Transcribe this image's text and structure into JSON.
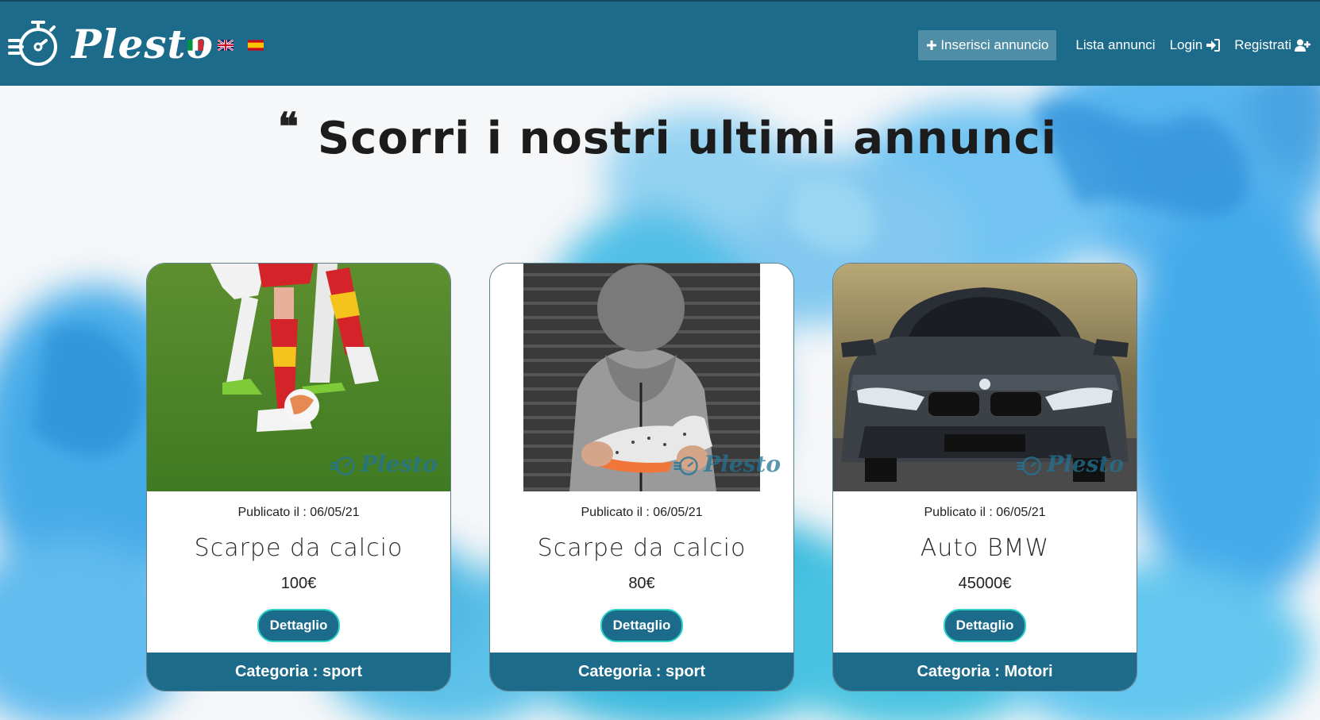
{
  "navbar": {
    "brand": "Plesto",
    "flags": [
      "italian-flag",
      "uk-flag",
      "spanish-flag"
    ],
    "insert_label": "Inserisci annuncio",
    "list_label": "Lista annunci",
    "login_label": "Login",
    "register_label": "Registrati",
    "background_color": "#1d6b8b"
  },
  "headline": {
    "quote": "❝",
    "text": "Scorri i nostri ultimi annunci"
  },
  "cards": [
    {
      "image": "soccer-players-photo",
      "date": "Publicato il : 06/05/21",
      "title": "Scarpe da calcio",
      "price": "100€",
      "button": "Dettaglio",
      "category": "Categoria : sport"
    },
    {
      "image": "person-holding-cleat-photo",
      "date": "Publicato il : 06/05/21",
      "title": "Scarpe da calcio",
      "price": "80€",
      "button": "Dettaglio",
      "category": "Categoria : sport"
    },
    {
      "image": "bmw-car-photo",
      "date": "Publicato il : 06/05/21",
      "title": "Auto BMW",
      "price": "45000€",
      "button": "Dettaglio",
      "category": "Categoria : Motori"
    }
  ],
  "watermark": "Plesto"
}
